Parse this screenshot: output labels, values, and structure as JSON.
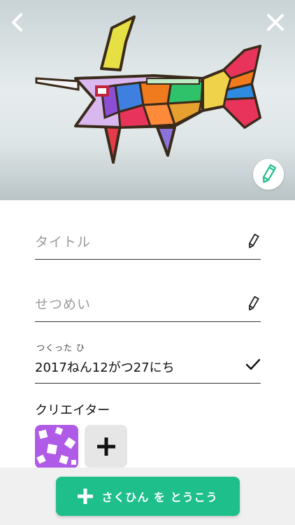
{
  "photo": {
    "subject": "stained glass swordfish artwork",
    "back_icon": "chevron-left-icon",
    "close_icon": "close-icon",
    "edit_icon": "pencil-icon"
  },
  "form": {
    "title_placeholder": "タイトル",
    "description_placeholder": "せつめい",
    "date_label": "つくった ひ",
    "date_value": "2017ねん12がつ27にち"
  },
  "creators": {
    "label": "クリエイター",
    "avatar_color": "#b05ae8",
    "add_icon": "plus-icon"
  },
  "footer": {
    "post_label": "さくひん を とうこう",
    "accent": "#1fbf8c"
  }
}
